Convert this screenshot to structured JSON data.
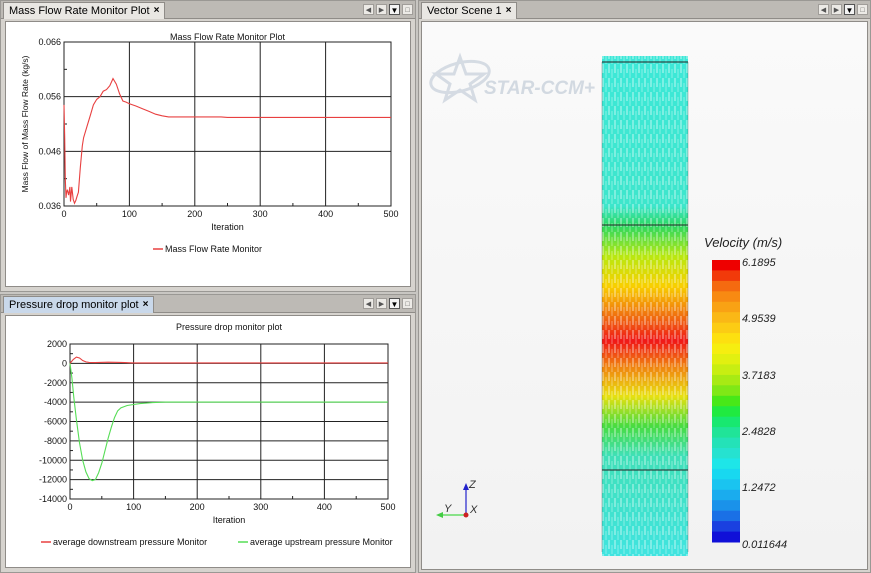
{
  "panels": {
    "mass_flow": {
      "tab_label": "Mass Flow Rate Monitor Plot",
      "close_glyph": "×",
      "controls": [
        "◀",
        "▶",
        "▼",
        "□"
      ]
    },
    "pressure": {
      "tab_label": "Pressure drop monitor plot",
      "close_glyph": "×",
      "controls": [
        "◀",
        "▶",
        "▼",
        "□"
      ]
    },
    "vector_scene": {
      "tab_label": "Vector Scene 1",
      "close_glyph": "×",
      "controls": [
        "◀",
        "▶",
        "▼",
        "□"
      ],
      "logo_text": "STAR-CCM+",
      "legend_title": "Velocity (m/s)",
      "legend_ticks": [
        "6.1895",
        "4.9539",
        "3.7183",
        "2.4828",
        "1.2472",
        "0.011644"
      ],
      "axes_labels": {
        "z": "Z",
        "y": "Y",
        "x": "X"
      },
      "colors": {
        "axis_z": "#2222cc",
        "axis_y": "#44cc44",
        "axis_x": "#cc2222"
      }
    }
  },
  "chart_data": [
    {
      "type": "line",
      "title": "Mass Flow Rate Monitor Plot",
      "xlabel": "Iteration",
      "ylabel": "Mass Flow of Mass Flow Rate (kg/s)",
      "xlim": [
        0,
        500
      ],
      "ylim": [
        0.036,
        0.066
      ],
      "xticks": [
        0,
        100,
        200,
        300,
        400,
        500
      ],
      "yticks": [
        "0.036",
        "0.046",
        "0.056",
        "0.066"
      ],
      "yticks_values": [
        0.036,
        0.046,
        0.056,
        0.066
      ],
      "grid": true,
      "legend": "bottom",
      "series": [
        {
          "name": "Mass Flow Rate Monitor",
          "color": "#e84040",
          "x": [
            0,
            1,
            2,
            3,
            4,
            5,
            7,
            9,
            10,
            12,
            14,
            16,
            18,
            20,
            22,
            25,
            28,
            30,
            35,
            40,
            45,
            50,
            55,
            60,
            65,
            70,
            75,
            80,
            85,
            90,
            95,
            100,
            110,
            120,
            130,
            140,
            150,
            160,
            180,
            200,
            240,
            250,
            300,
            400,
            500
          ],
          "y": [
            0.0545,
            0.0485,
            0.041,
            0.0375,
            0.0385,
            0.039,
            0.038,
            0.0395,
            0.0368,
            0.0395,
            0.0372,
            0.0365,
            0.037,
            0.0378,
            0.0385,
            0.043,
            0.047,
            0.0485,
            0.0505,
            0.0525,
            0.0545,
            0.0555,
            0.056,
            0.057,
            0.0573,
            0.058,
            0.0593,
            0.0583,
            0.0565,
            0.0552,
            0.055,
            0.0547,
            0.0543,
            0.0538,
            0.0533,
            0.0528,
            0.0525,
            0.0523,
            0.0523,
            0.0523,
            0.0523,
            0.0522,
            0.0522,
            0.0522,
            0.0522
          ]
        }
      ]
    },
    {
      "type": "line",
      "title": "Pressure drop monitor plot",
      "xlabel": "Iteration",
      "ylabel": "",
      "xlim": [
        0,
        500
      ],
      "ylim": [
        -14000,
        2000
      ],
      "xticks": [
        0,
        100,
        200,
        300,
        400,
        500
      ],
      "yticks": [
        "2000",
        "0",
        "-2000",
        "-4000",
        "-6000",
        "-8000",
        "-10000",
        "-12000",
        "-14000"
      ],
      "yticks_values": [
        2000,
        0,
        -2000,
        -4000,
        -6000,
        -8000,
        -10000,
        -12000,
        -14000
      ],
      "grid": true,
      "legend": "bottom",
      "series": [
        {
          "name": "average downstream pressure Monitor",
          "color": "#e84040",
          "x": [
            0,
            5,
            10,
            15,
            20,
            25,
            30,
            40,
            60,
            80,
            100,
            200,
            300,
            400,
            500
          ],
          "y": [
            0,
            400,
            650,
            550,
            300,
            150,
            100,
            80,
            120,
            100,
            50,
            50,
            50,
            50,
            50
          ],
          "lines_after_150_thick": false
        },
        {
          "name": "average upstream pressure Monitor",
          "color": "#55dd55",
          "x": [
            0,
            3,
            6,
            10,
            15,
            20,
            25,
            30,
            35,
            40,
            45,
            50,
            55,
            60,
            65,
            70,
            75,
            80,
            90,
            100,
            110,
            120,
            130,
            150,
            200,
            300,
            400,
            500
          ],
          "y": [
            0,
            -1500,
            -3500,
            -5800,
            -8200,
            -10000,
            -11200,
            -11900,
            -12100,
            -12000,
            -11300,
            -10300,
            -9000,
            -7700,
            -6600,
            -5600,
            -4900,
            -4600,
            -4350,
            -4250,
            -4150,
            -4100,
            -4050,
            -4000,
            -4000,
            -4000,
            -4000,
            -4000
          ]
        }
      ]
    }
  ]
}
